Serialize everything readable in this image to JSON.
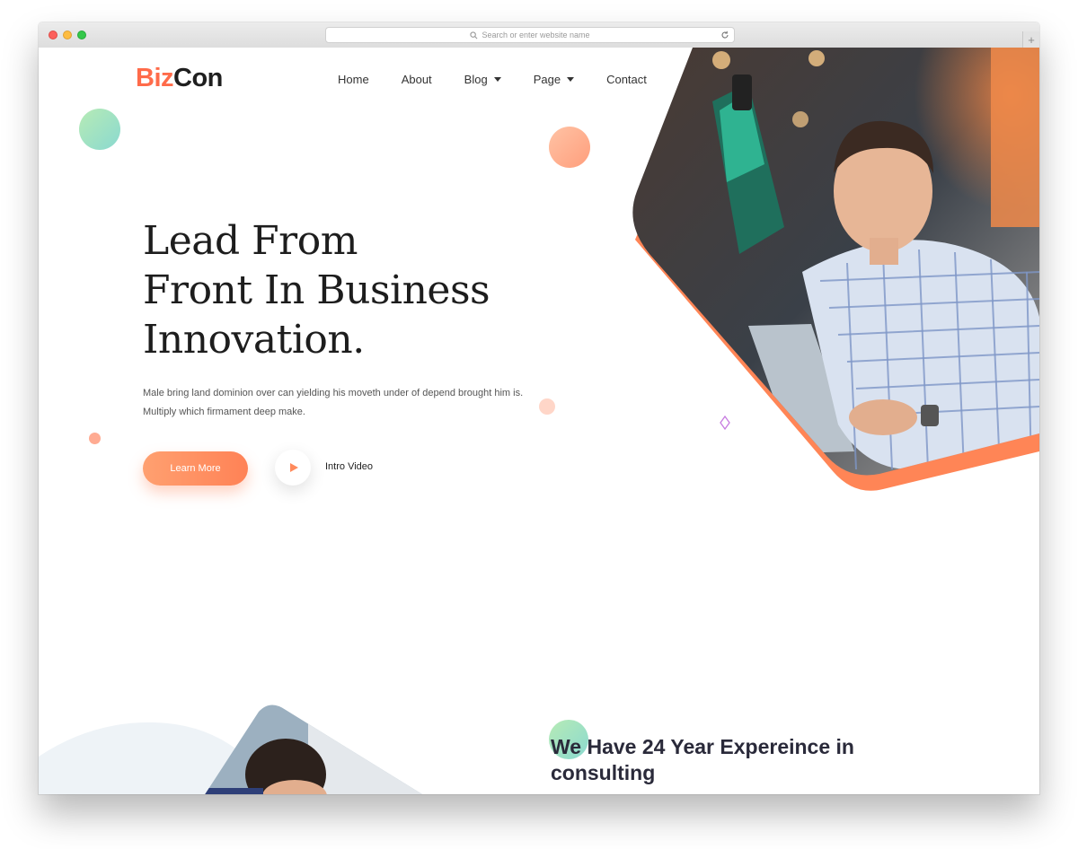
{
  "browser": {
    "address_placeholder": "Search or enter website name",
    "new_tab_label": "+"
  },
  "brand": {
    "part1": "Biz",
    "part2": "Con"
  },
  "nav": [
    {
      "label": "Home",
      "dropdown": false
    },
    {
      "label": "About",
      "dropdown": false
    },
    {
      "label": "Blog",
      "dropdown": true
    },
    {
      "label": "Page",
      "dropdown": true
    },
    {
      "label": "Contact",
      "dropdown": false
    }
  ],
  "hero": {
    "title_lines": [
      "Lead From",
      "Front In Business",
      "Innovation."
    ],
    "description_lines": [
      "Male bring land dominion over can yielding his moveth under of depend brought him is.",
      "Multiply which firmament deep make."
    ],
    "learn_more_label": "Learn More",
    "intro_video_label": "Intro Video"
  },
  "section2": {
    "title_lines": [
      "We Have 24 Year Expereince in",
      "consulting"
    ]
  },
  "colors": {
    "accent": "#ff8256",
    "brand_orange": "#ff6b4a",
    "green_bubble": "#9fe0c0",
    "text_dark": "#1d1d1d"
  },
  "icons": [
    "search-icon",
    "reload-icon",
    "play-icon",
    "diamond-icon",
    "caret-down-icon"
  ]
}
